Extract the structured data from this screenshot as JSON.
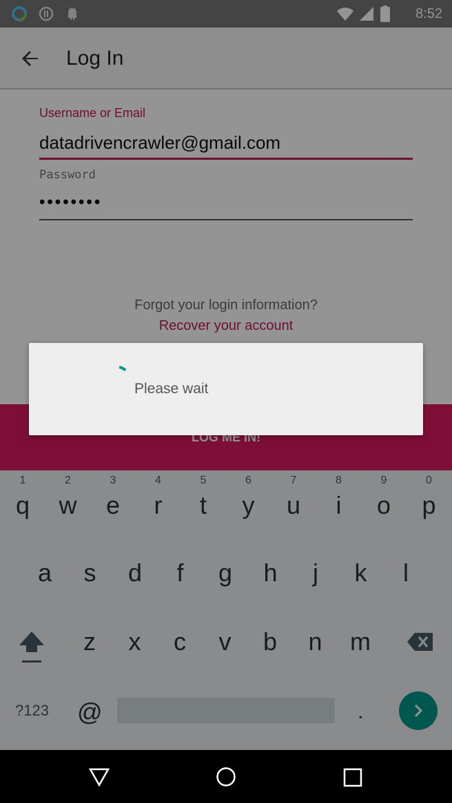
{
  "app_bar": {
    "title": "Log In",
    "back_icon": "arrow-left-icon"
  },
  "status_bar": {
    "time": "8:52",
    "left_icons": [
      "ring-app-icon",
      "info-circle-icon",
      "android-icon"
    ],
    "right_icons": [
      "wifi-icon",
      "signal-icon",
      "battery-icon"
    ]
  },
  "form": {
    "username_label": "Username or Email",
    "username_value": "datadrivencrawler@gmail.com",
    "password_label": "Password",
    "password_value": "••••••••"
  },
  "forgot_text": "Forgot your login information?",
  "recover_link": "Recover your account",
  "login_button": "LOG ME IN!",
  "dialog": {
    "message": "Please wait"
  },
  "keyboard": {
    "row1": [
      {
        "key": "q",
        "num": "1"
      },
      {
        "key": "w",
        "num": "2"
      },
      {
        "key": "e",
        "num": "3"
      },
      {
        "key": "r",
        "num": "4"
      },
      {
        "key": "t",
        "num": "5"
      },
      {
        "key": "y",
        "num": "6"
      },
      {
        "key": "u",
        "num": "7"
      },
      {
        "key": "i",
        "num": "8"
      },
      {
        "key": "o",
        "num": "9"
      },
      {
        "key": "p",
        "num": "0"
      }
    ],
    "row2": [
      "a",
      "s",
      "d",
      "f",
      "g",
      "h",
      "j",
      "k",
      "l"
    ],
    "row3": [
      "z",
      "x",
      "c",
      "v",
      "b",
      "n",
      "m"
    ],
    "symbols_key": "?123",
    "at_key": "@",
    "period_key": "."
  },
  "colors": {
    "accent": "#c2185b",
    "button": "#d81b60",
    "enter": "#009688"
  }
}
